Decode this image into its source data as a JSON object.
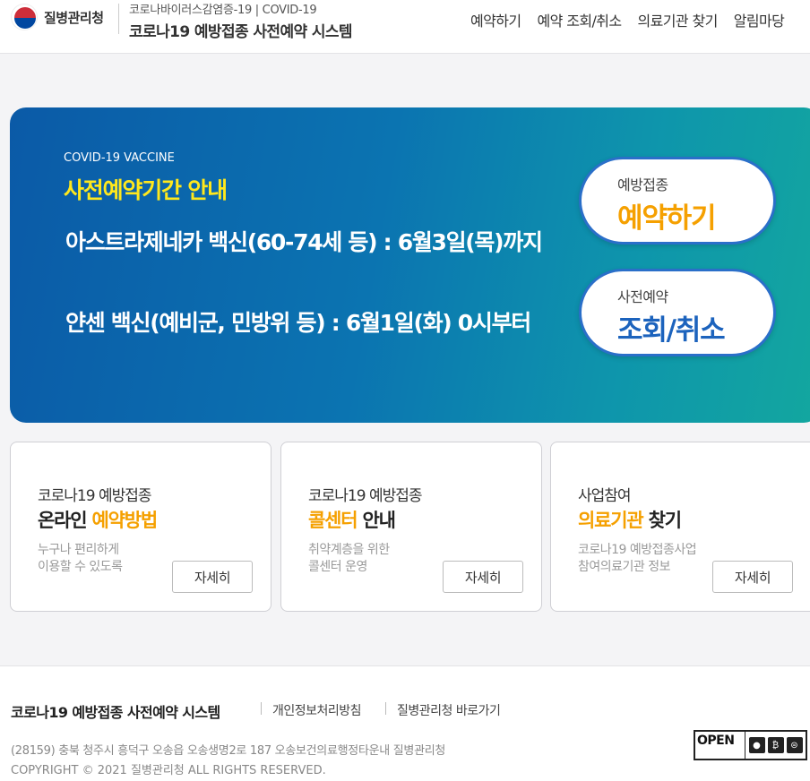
{
  "header": {
    "logo_text": "질병관리청",
    "subtitle": "코로나바이러스감염증-19 | COVID-19",
    "title": "코로나19 예방접종 사전예약 시스템",
    "nav": [
      "예약하기",
      "예약 조회/취소",
      "의료기관 찾기",
      "알림마당"
    ]
  },
  "banner": {
    "eyebrow": "COVID-19 VACCINE",
    "title": "사전예약기간 안내",
    "line1": "아스트라제네카 백신(60-74세 등) : 6월3일(목)까지",
    "line2": "얀센 백신(예비군, 민방위 등) : 6월1일(화) 0시부터",
    "reserve": {
      "small": "예방접종",
      "big": "예약하기"
    },
    "lookup": {
      "small": "사전예약",
      "big": "조회/취소"
    }
  },
  "cards": [
    {
      "kicker": "코로나19 예방접종",
      "heading_main": "온라인 ",
      "heading_accent": "예약방법",
      "heading_tail": "",
      "desc1": "누구나 편리하게",
      "desc2": "이용할 수 있도록",
      "button": "자세히"
    },
    {
      "kicker": "코로나19 예방접종",
      "heading_main": "",
      "heading_accent": "콜센터",
      "heading_tail": " 안내",
      "desc1": "취약계층을 위한",
      "desc2": "콜센터 운영",
      "button": "자세히"
    },
    {
      "kicker": "사업참여",
      "heading_main": "",
      "heading_accent": "의료기관",
      "heading_tail": " 찾기",
      "desc1": "코로나19 예방접종사업",
      "desc2": "참여의료기관 정보",
      "button": "자세히"
    }
  ],
  "footer": {
    "title": "코로나19 예방접종 사전예약 시스템",
    "link_privacy": "개인정보처리방침",
    "link_kdca": "질병관리청 바로가기",
    "address": "(28159) 충북 청주시 흥덕구 오송읍 오송생명2로 187 오송보건의료행정타운내 질병관리청",
    "copyright": "COPYRIGHT © 2021 질병관리청 ALL RIGHTS RESERVED.",
    "open_badge": "OPEN"
  },
  "colors": {
    "accent_yellow": "#f5a000",
    "banner_title": "#ffe81c",
    "blue": "#1c63bd"
  }
}
